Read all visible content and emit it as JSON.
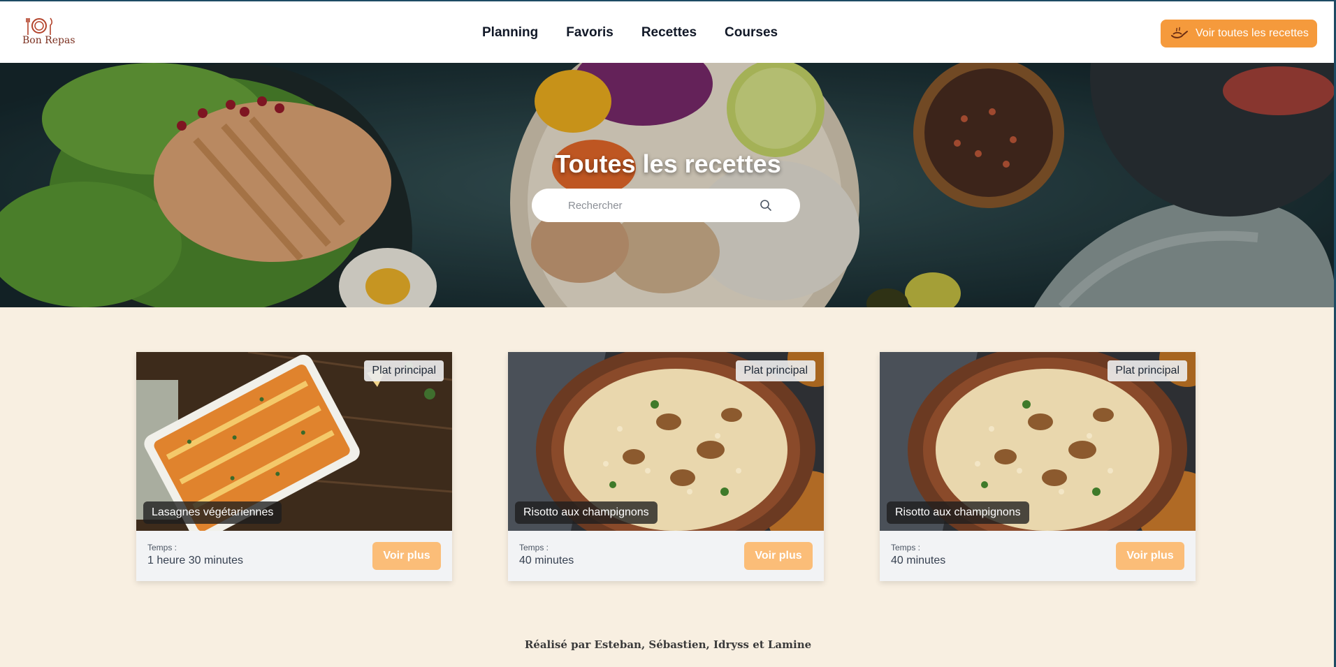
{
  "header": {
    "logo_text": "Bon Repas",
    "nav": [
      "Planning",
      "Favoris",
      "Recettes",
      "Courses"
    ],
    "cta_label": "Voir toutes les recettes",
    "cta_icon": "chef-pan-icon"
  },
  "hero": {
    "title": "Toutes les recettes",
    "search_placeholder": "Rechercher"
  },
  "cards": [
    {
      "category": "Plat principal",
      "title": "Lasagnes végétariennes",
      "time_label": "Temps :",
      "time_value": "1 heure 30 minutes",
      "button": "Voir plus"
    },
    {
      "category": "Plat principal",
      "title": "Risotto aux champignons",
      "time_label": "Temps :",
      "time_value": "40 minutes",
      "button": "Voir plus"
    },
    {
      "category": "Plat principal",
      "title": "Risotto aux champignons",
      "time_label": "Temps :",
      "time_value": "40 minutes",
      "button": "Voir plus"
    }
  ],
  "footer": {
    "credits": "Réalisé par Esteban, Sébastien, Idryss et Lamine"
  },
  "colors": {
    "accent": "#f59a3c",
    "button_soft": "#fbbd78",
    "page_bg": "#f8efe1"
  }
}
